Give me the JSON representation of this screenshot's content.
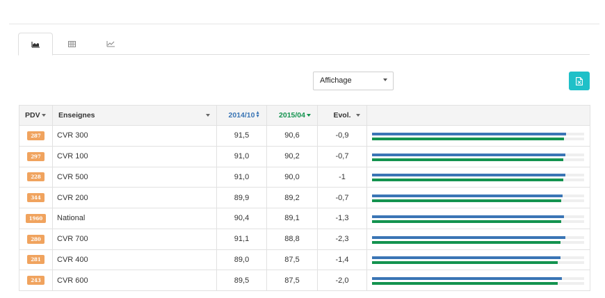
{
  "tabs": [
    {
      "icon": "area-chart-icon",
      "active": true
    },
    {
      "icon": "table-icon",
      "active": false
    },
    {
      "icon": "line-chart-icon",
      "active": false
    }
  ],
  "display_select": {
    "value": "Affichage"
  },
  "export_button": {
    "icon": "excel-file-icon"
  },
  "colors": {
    "series_a": "#3a75b5",
    "series_b": "#14934f",
    "badge": "#f0a35e",
    "accent": "#1fc0c8"
  },
  "table": {
    "headers": {
      "pdv": "PDV",
      "enseignes": "Enseignes",
      "period_a": "2014/10",
      "period_b": "2015/04",
      "evol": "Evol."
    },
    "bar_max": 100,
    "rows": [
      {
        "pdv": "287",
        "name": "CVR 300",
        "a": "91,5",
        "b": "90,6",
        "evol": "-0,9",
        "a_val": 91.5,
        "b_val": 90.6
      },
      {
        "pdv": "297",
        "name": "CVR 100",
        "a": "91,0",
        "b": "90,2",
        "evol": "-0,7",
        "a_val": 91.0,
        "b_val": 90.2
      },
      {
        "pdv": "228",
        "name": "CVR 500",
        "a": "91,0",
        "b": "90,0",
        "evol": "-1",
        "a_val": 91.0,
        "b_val": 90.0
      },
      {
        "pdv": "344",
        "name": "CVR 200",
        "a": "89,9",
        "b": "89,2",
        "evol": "-0,7",
        "a_val": 89.9,
        "b_val": 89.2
      },
      {
        "pdv": "1960",
        "name": "National",
        "a": "90,4",
        "b": "89,1",
        "evol": "-1,3",
        "a_val": 90.4,
        "b_val": 89.1
      },
      {
        "pdv": "280",
        "name": "CVR 700",
        "a": "91,1",
        "b": "88,8",
        "evol": "-2,3",
        "a_val": 91.1,
        "b_val": 88.8
      },
      {
        "pdv": "281",
        "name": "CVR 400",
        "a": "89,0",
        "b": "87,5",
        "evol": "-1,4",
        "a_val": 89.0,
        "b_val": 87.5
      },
      {
        "pdv": "243",
        "name": "CVR 600",
        "a": "89,5",
        "b": "87,5",
        "evol": "-2,0",
        "a_val": 89.5,
        "b_val": 87.5
      }
    ]
  }
}
